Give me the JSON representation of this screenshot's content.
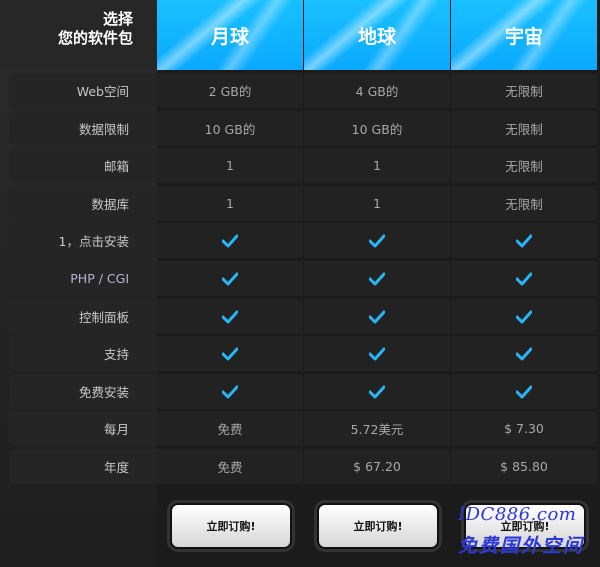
{
  "header": {
    "choose_line1": "选择",
    "choose_line2": "您的软件包",
    "plans": [
      "月球",
      "地球",
      "宇宙"
    ]
  },
  "features": [
    "Web空间",
    "数据限制",
    "邮箱",
    "数据库",
    "1，点击安装",
    "PHP / CGI",
    "控制面板",
    "支持",
    "免费安装",
    "每月",
    "年度"
  ],
  "rows": [
    [
      "2 GB的",
      "4 GB的",
      "无限制"
    ],
    [
      "10 GB的",
      "10 GB的",
      "无限制"
    ],
    [
      "1",
      "1",
      "无限制"
    ],
    [
      "1",
      "1",
      "无限制"
    ],
    [
      "check",
      "check",
      "check"
    ],
    [
      "check",
      "check",
      "check"
    ],
    [
      "check",
      "check",
      "check"
    ],
    [
      "check",
      "check",
      "check"
    ],
    [
      "check",
      "check",
      "check"
    ],
    [
      "免费",
      "5.72美元",
      "$ 7.30"
    ],
    [
      "免费",
      "$ 67.20",
      "$ 85.80"
    ]
  ],
  "order_button_label": "立即订购!",
  "watermark": {
    "line1": "IDC886.com",
    "line2": "免费国外空间"
  },
  "colors": {
    "accent": "#0db1ff",
    "check": "#29b6f6",
    "watermark": "#2c38d7"
  },
  "icons": {
    "check": "check-icon"
  }
}
